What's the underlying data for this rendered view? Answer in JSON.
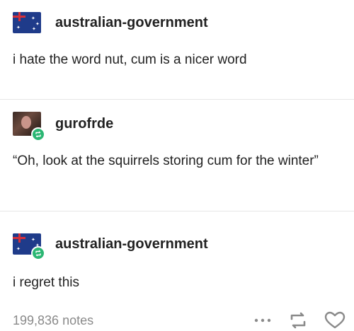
{
  "posts": [
    {
      "username": "australian-government",
      "avatar_icon": "australia-flag-avatar",
      "text": "i hate the word nut, cum is a nicer word"
    },
    {
      "username": "gurofrde",
      "avatar_icon": "user-photo-avatar",
      "reblog_icon": "reblog-badge-icon",
      "text": "“Oh, look at the squirrels storing cum for the winter”"
    },
    {
      "username": "australian-government",
      "avatar_icon": "australia-flag-avatar",
      "reblog_icon": "reblog-badge-icon",
      "text": "i regret this"
    }
  ],
  "footer": {
    "notes": "199,836 notes",
    "more_icon": "more-options-icon",
    "reblog_icon": "reblog-icon",
    "like_icon": "heart-icon"
  },
  "colors": {
    "text": "#222222",
    "muted": "#8a8a8a",
    "divider": "#e6e6e6",
    "reblog_badge": "#2bb673"
  }
}
